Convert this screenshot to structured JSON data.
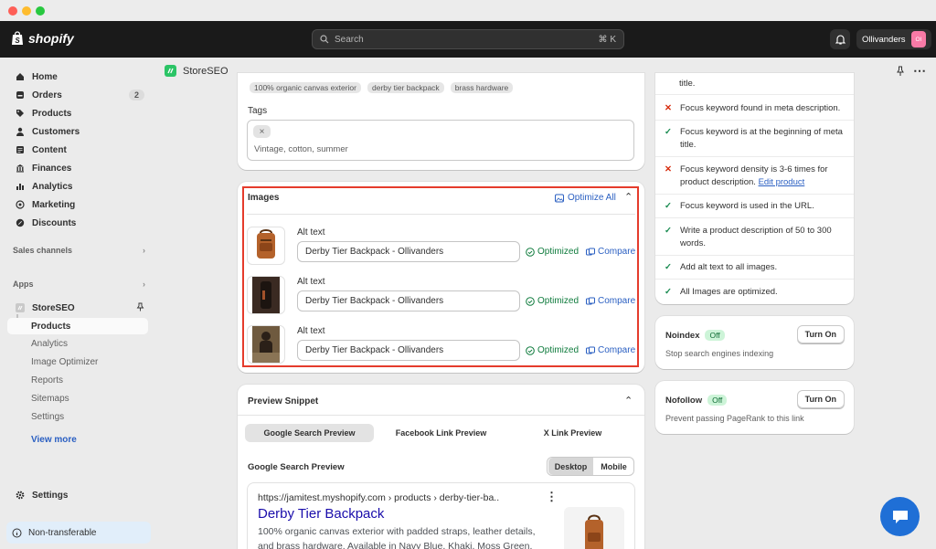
{
  "topbar": {
    "brand": "shopify",
    "search_placeholder": "Search",
    "search_shortcut": "⌘ K",
    "store_name": "Ollivanders",
    "store_initials": "Ol"
  },
  "sidebar": {
    "main_items": [
      {
        "label": "Home"
      },
      {
        "label": "Orders",
        "badge": "2"
      },
      {
        "label": "Products"
      },
      {
        "label": "Customers"
      },
      {
        "label": "Content"
      },
      {
        "label": "Finances"
      },
      {
        "label": "Analytics"
      },
      {
        "label": "Marketing"
      },
      {
        "label": "Discounts"
      }
    ],
    "sales_channels_label": "Sales channels",
    "apps_label": "Apps",
    "app_name": "StoreSEO",
    "app_subitems": [
      {
        "label": "Products"
      },
      {
        "label": "Analytics"
      },
      {
        "label": "Image Optimizer"
      },
      {
        "label": "Reports"
      },
      {
        "label": "Sitemaps"
      },
      {
        "label": "Settings"
      }
    ],
    "view_more": "View more",
    "settings": "Settings",
    "non_transferable": "Non-transferable"
  },
  "app_header": {
    "title": "StoreSEO"
  },
  "keywords": {
    "chips": [
      "100% organic canvas exterior",
      "derby tier backpack",
      "brass hardware"
    ]
  },
  "tags": {
    "label": "Tags",
    "remove_symbol": "×",
    "placeholder": "Vintage, cotton, summer"
  },
  "images": {
    "title": "Images",
    "optimize_all": "Optimize All",
    "rows": [
      {
        "alt_label": "Alt text",
        "alt_value": "Derby Tier Backpack - Ollivanders",
        "status": "Optimized",
        "compare": "Compare"
      },
      {
        "alt_label": "Alt text",
        "alt_value": "Derby Tier Backpack - Ollivanders",
        "status": "Optimized",
        "compare": "Compare"
      },
      {
        "alt_label": "Alt text",
        "alt_value": "Derby Tier Backpack - Ollivanders",
        "status": "Optimized",
        "compare": "Compare"
      }
    ]
  },
  "preview": {
    "title": "Preview Snippet",
    "tabs": [
      "Google Search Preview",
      "Facebook Link Preview",
      "X Link Preview"
    ],
    "section_title": "Google Search Preview",
    "device_options": [
      "Desktop",
      "Mobile"
    ],
    "url": "https://jamitest.myshopify.com › products › derby-tier-ba..",
    "result_title": "Derby Tier Backpack",
    "result_desc": "100% organic canvas exterior with padded straps, leather details, and brass hardware. Available in Navy Blue, Khaki, Moss Green."
  },
  "checklist": {
    "truncated_top": "title.",
    "items": [
      {
        "status": "fail",
        "text": "Focus keyword found in meta description."
      },
      {
        "status": "pass",
        "text": "Focus keyword is at the beginning of meta title."
      },
      {
        "status": "fail",
        "text": "Focus keyword density is 3-6 times for product description.",
        "link": "Edit product"
      },
      {
        "status": "pass",
        "text": "Focus keyword is used in the URL."
      },
      {
        "status": "pass",
        "text": "Write a product description of 50 to 300 words."
      },
      {
        "status": "pass",
        "text": "Add alt text to all images."
      },
      {
        "status": "pass",
        "text": "All Images are optimized."
      }
    ]
  },
  "noindex": {
    "title": "Noindex",
    "status": "Off",
    "button": "Turn On",
    "description": "Stop search engines indexing"
  },
  "nofollow": {
    "title": "Nofollow",
    "status": "Off",
    "button": "Turn On",
    "description": "Prevent passing PageRank to this link"
  },
  "colors": {
    "accent": "#2a5fc2",
    "success": "#178a4f",
    "error": "#d72c0d",
    "highlight": "#e53b2c",
    "link_title": "#1a0dab"
  }
}
